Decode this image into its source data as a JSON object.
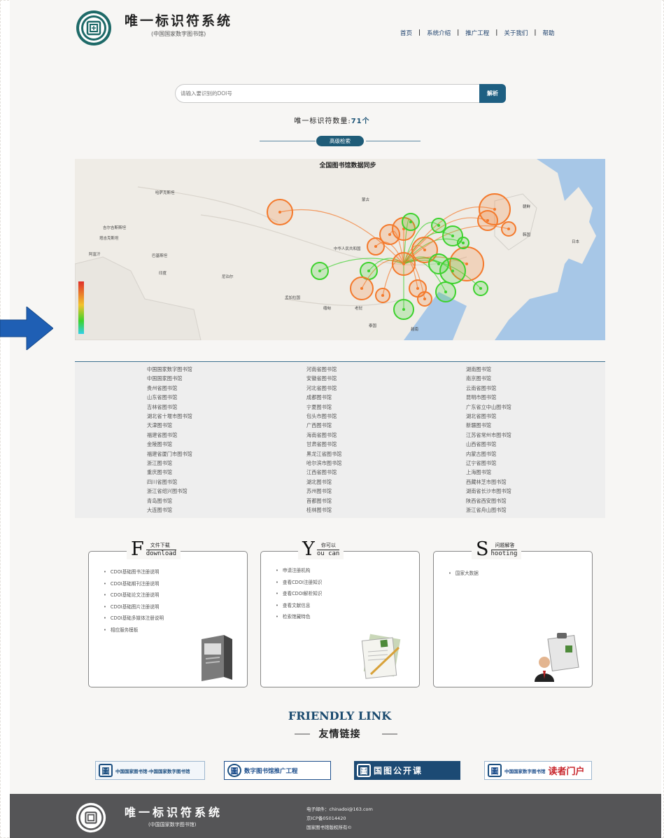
{
  "header": {
    "site_title": "唯一标识符系统",
    "site_subtitle": "(中国国家数字图书馆)",
    "nav": [
      "首页",
      "系统介绍",
      "推广工程",
      "关于我们",
      "帮助"
    ]
  },
  "search": {
    "placeholder": "请输入要识别的DOI号",
    "button_label": "解析",
    "count_label": "唯一标识符数量:",
    "count_value": "71个",
    "advanced_label": "高级检索"
  },
  "map": {
    "title": "全国图书馆数据同步",
    "labels": [
      "哈萨克斯坦",
      "蒙古",
      "中华人民共和国",
      "吉尔吉斯斯坦",
      "塔吉克斯坦",
      "阿富汗",
      "巴基斯坦",
      "印度",
      "尼泊尔",
      "孟加拉国",
      "缅甸",
      "老挝",
      "泰国",
      "越南",
      "朝鲜",
      "韩国",
      "日本"
    ],
    "colors": {
      "land": "#efece6",
      "sea": "#a7c7e7",
      "hot": "#f4792b",
      "cool": "#3dd22d"
    }
  },
  "libraries": {
    "columns": [
      [
        "中国国家数字图书馆",
        "中国国家图书馆",
        "贵州省图书馆",
        "山东省图书馆",
        "吉林省图书馆",
        "湖北省十堰市图书馆",
        "天津图书馆",
        "福建省图书馆",
        "金陵图书馆",
        "福建省厦门市图书馆",
        "浙江图书馆",
        "重庆图书馆",
        "四川省图书馆",
        "浙江省绍兴图书馆",
        "青岛图书馆",
        "大连图书馆"
      ],
      [
        "河南省图书馆",
        "安徽省图书馆",
        "河北省图书馆",
        "成都图书馆",
        "宁夏图书馆",
        "包头市图书馆",
        "广西图书馆",
        "海南省图书馆",
        "甘肃省图书馆",
        "黑龙江省图书馆",
        "哈尔滨市图书馆",
        "江西省图书馆",
        "湖北图书馆",
        "苏州图书馆",
        "首都图书馆",
        "桂林图书馆"
      ],
      [
        "湖南图书馆",
        "南京图书馆",
        "云南省图书馆",
        "昆明市图书馆",
        "广东省立中山图书馆",
        "湖北省图书馆",
        "新疆图书馆",
        "江苏省常州市图书馆",
        "山西省图书馆",
        "内蒙古图书馆",
        "辽宁省图书馆",
        "上海图书馆",
        "西藏林芝市图书馆",
        "湖南省长沙市图书馆",
        "陕西省西安图书馆",
        "浙江省舟山图书馆"
      ]
    ]
  },
  "cards": [
    {
      "letter": "F",
      "cn": "文件下载",
      "en": "download",
      "items": [
        "CDOI基础图书注册说明",
        "CDOI基础期刊注册说明",
        "CDOI基础论文注册说明",
        "CDOI基础图片注册说明",
        "CDOI基础多媒体注册说明",
        "相应服务模板"
      ]
    },
    {
      "letter": "Y",
      "cn": "你可以",
      "en": "ou can",
      "items": [
        "申请注册机构",
        "查看CDOI注册知识",
        "查看CDOI解析知识",
        "查看文献信息",
        "检索馆藏特色"
      ]
    },
    {
      "letter": "S",
      "cn": "问题解答",
      "en": "hooting",
      "items": [
        "国家大数据"
      ]
    }
  ],
  "friendly_links": {
    "title": "FRIENDLY LINK",
    "subtitle": "友情链接",
    "partners": [
      {
        "label": "中国国家图书馆·中国国家数字图书馆",
        "color": "#1c4f80"
      },
      {
        "label": "数字图书馆推广工程",
        "color": "#1d4e8c"
      },
      {
        "label": "国图公开课",
        "color": "#ffffff"
      },
      {
        "label": "中国国家数字图书馆",
        "extra": "读者门户",
        "color": "#1d4e8c",
        "accent": "#c8262c"
      }
    ]
  },
  "footer": {
    "title": "唯一标识符系统",
    "subtitle": "(中国国家数字图书馆)",
    "email": "电子邮件：chinadoi@163.com",
    "icp": "京ICP备05014420",
    "security": "国家图书馆版权所有©"
  }
}
